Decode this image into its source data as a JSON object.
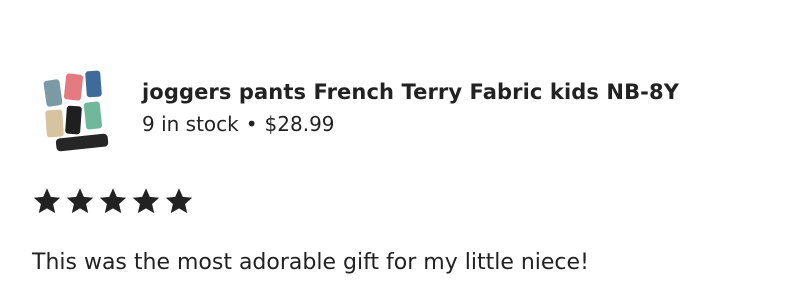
{
  "product": {
    "title": "joggers pants French Terry Fabric kids NB-8Y",
    "stock": "9 in stock",
    "separator": "•",
    "price": "$28.99",
    "thumbnail_icon": "product-thumbnail-pants-stack"
  },
  "review": {
    "rating": 5,
    "rating_max": 5,
    "star_color": "#222222",
    "text": "This was the most adorable gift for my little niece!"
  }
}
